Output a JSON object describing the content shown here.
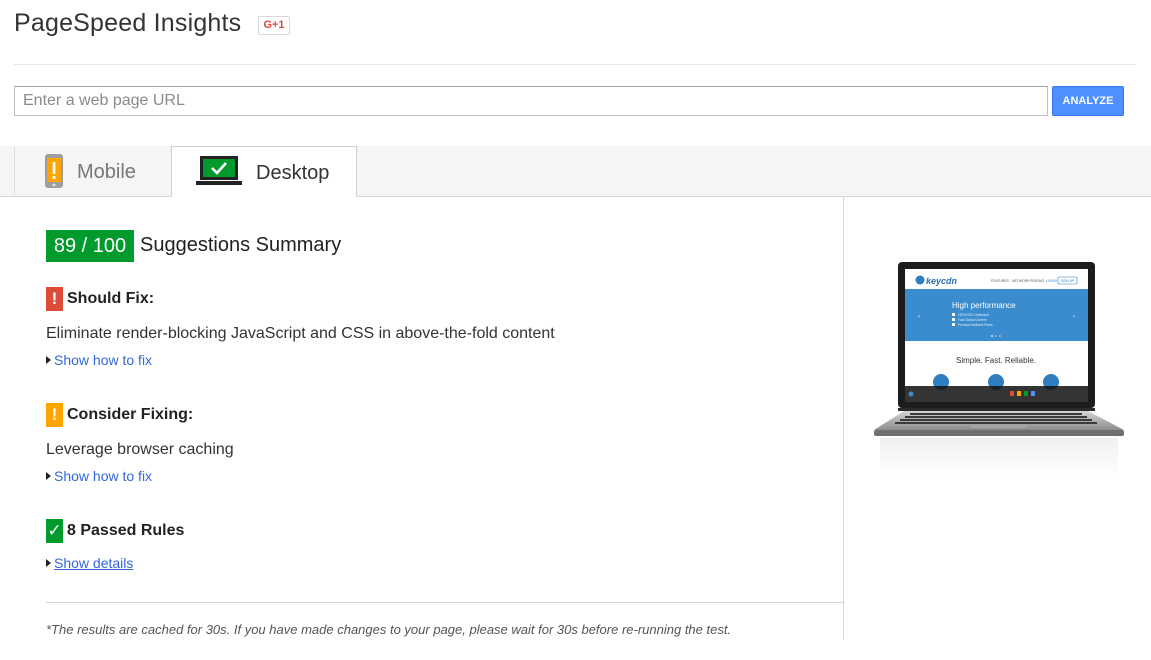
{
  "header": {
    "title": "PageSpeed Insights",
    "gplus_label": "G+1"
  },
  "search": {
    "placeholder": "Enter a web page URL",
    "value": "",
    "analyze_label": "ANALYZE"
  },
  "tabs": [
    {
      "label": "Mobile",
      "icon": "phone-warning-icon",
      "active": false
    },
    {
      "label": "Desktop",
      "icon": "laptop-check-icon",
      "active": true
    }
  ],
  "summary": {
    "score": "89 / 100",
    "title": "Suggestions Summary",
    "score_color": "#009a2d"
  },
  "rules": {
    "should_fix": {
      "title": "Should Fix:",
      "flag": "!",
      "color": "#dd4b39",
      "text": "Eliminate render-blocking JavaScript and CSS in above-the-fold content",
      "link": "Show how to fix"
    },
    "consider_fixing": {
      "title": "Consider Fixing:",
      "flag": "!",
      "color": "#ffa400",
      "text": "Leverage browser caching",
      "link": "Show how to fix"
    },
    "passed": {
      "title": "8 Passed Rules",
      "flag": "✓",
      "color": "#009a2d",
      "link": "Show details"
    }
  },
  "footer": {
    "note": "*The results are cached for 30s. If you have made changes to your page, please wait for 30s before re-running the test."
  },
  "preview": {
    "logo": "keycdn",
    "nav": [
      "FEATURES",
      "NETWORK",
      "PRICING",
      "LOGIN",
      "SIGN UP"
    ],
    "hero_title": "High performance",
    "hero_points": [
      "100% SSD Optimized",
      "Fast Global Content",
      "Premium Network Peers"
    ],
    "tagline": "Simple. Fast. Reliable."
  }
}
